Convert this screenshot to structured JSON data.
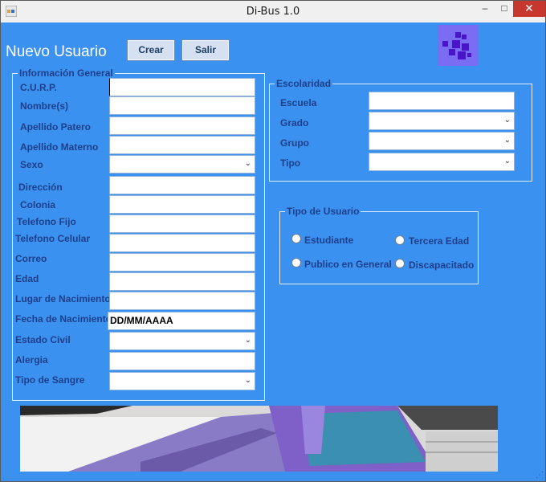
{
  "window": {
    "title": "Di-Bus 1.0",
    "minimize": "–",
    "maximize": "□",
    "close": "✕"
  },
  "form": {
    "heading": "Nuevo Usuario"
  },
  "toolbar": {
    "crear": "Crear",
    "salir": "Salir"
  },
  "general": {
    "title": "Información General",
    "curp": "C.U.R.P.",
    "nombre": "Nombre(s)",
    "apellido_paterno": "Apellido Patero",
    "apellido_materno": "Apellido Materno",
    "sexo": "Sexo",
    "direccion": "Dirección",
    "colonia": "Colonia",
    "telefono_fijo": "Telefono Fijo",
    "telefono_celular": "Telefono Celular",
    "correo": "Correo",
    "edad": "Edad",
    "lugar_nacimiento": "Lugar de Nacimiento",
    "fecha_nacimiento": "Fecha de Nacimiento",
    "fecha_value": "DD/MM/AAAA",
    "estado_civil": "Estado Civil",
    "alergia": "Alergia",
    "tipo_sangre": "Tipo de Sangre"
  },
  "escolaridad": {
    "title": "Escolaridad",
    "escuela": "Escuela",
    "grado": "Grado",
    "grupo": "Grupo",
    "tipo": "Tipo"
  },
  "tipo_usuario": {
    "title": "Tipo de Usuario",
    "estudiante": "Estudiante",
    "tercera_edad": "Tercera Edad",
    "publico": "Publico en General",
    "discapacitado": "Discapacitado"
  },
  "icons": {
    "dropdown": "chevron-down-icon",
    "app": "app-icon",
    "logo": "logo-squares-icon",
    "grip": "resize-grip-icon"
  },
  "colors": {
    "background": "#3a91f0",
    "label": "#1f3f8a",
    "logo": "#7b6cf4",
    "close": "#c8372d"
  }
}
